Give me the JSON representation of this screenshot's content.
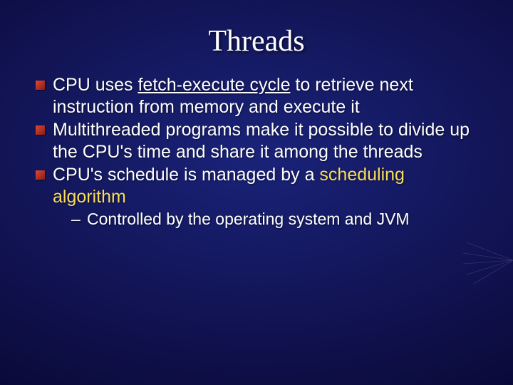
{
  "title": "Threads",
  "bullets": [
    {
      "pre": "CPU uses ",
      "underlined": "fetch-execute cycle",
      "post": " to retrieve next instruction from memory and execute it"
    },
    {
      "text": "Multithreaded programs make it possible to divide up the CPU's time and share it among the threads"
    },
    {
      "pre": "CPU's schedule is managed by a ",
      "highlight": "scheduling algorithm",
      "sub": [
        "Controlled by the operating system and JVM"
      ]
    }
  ]
}
